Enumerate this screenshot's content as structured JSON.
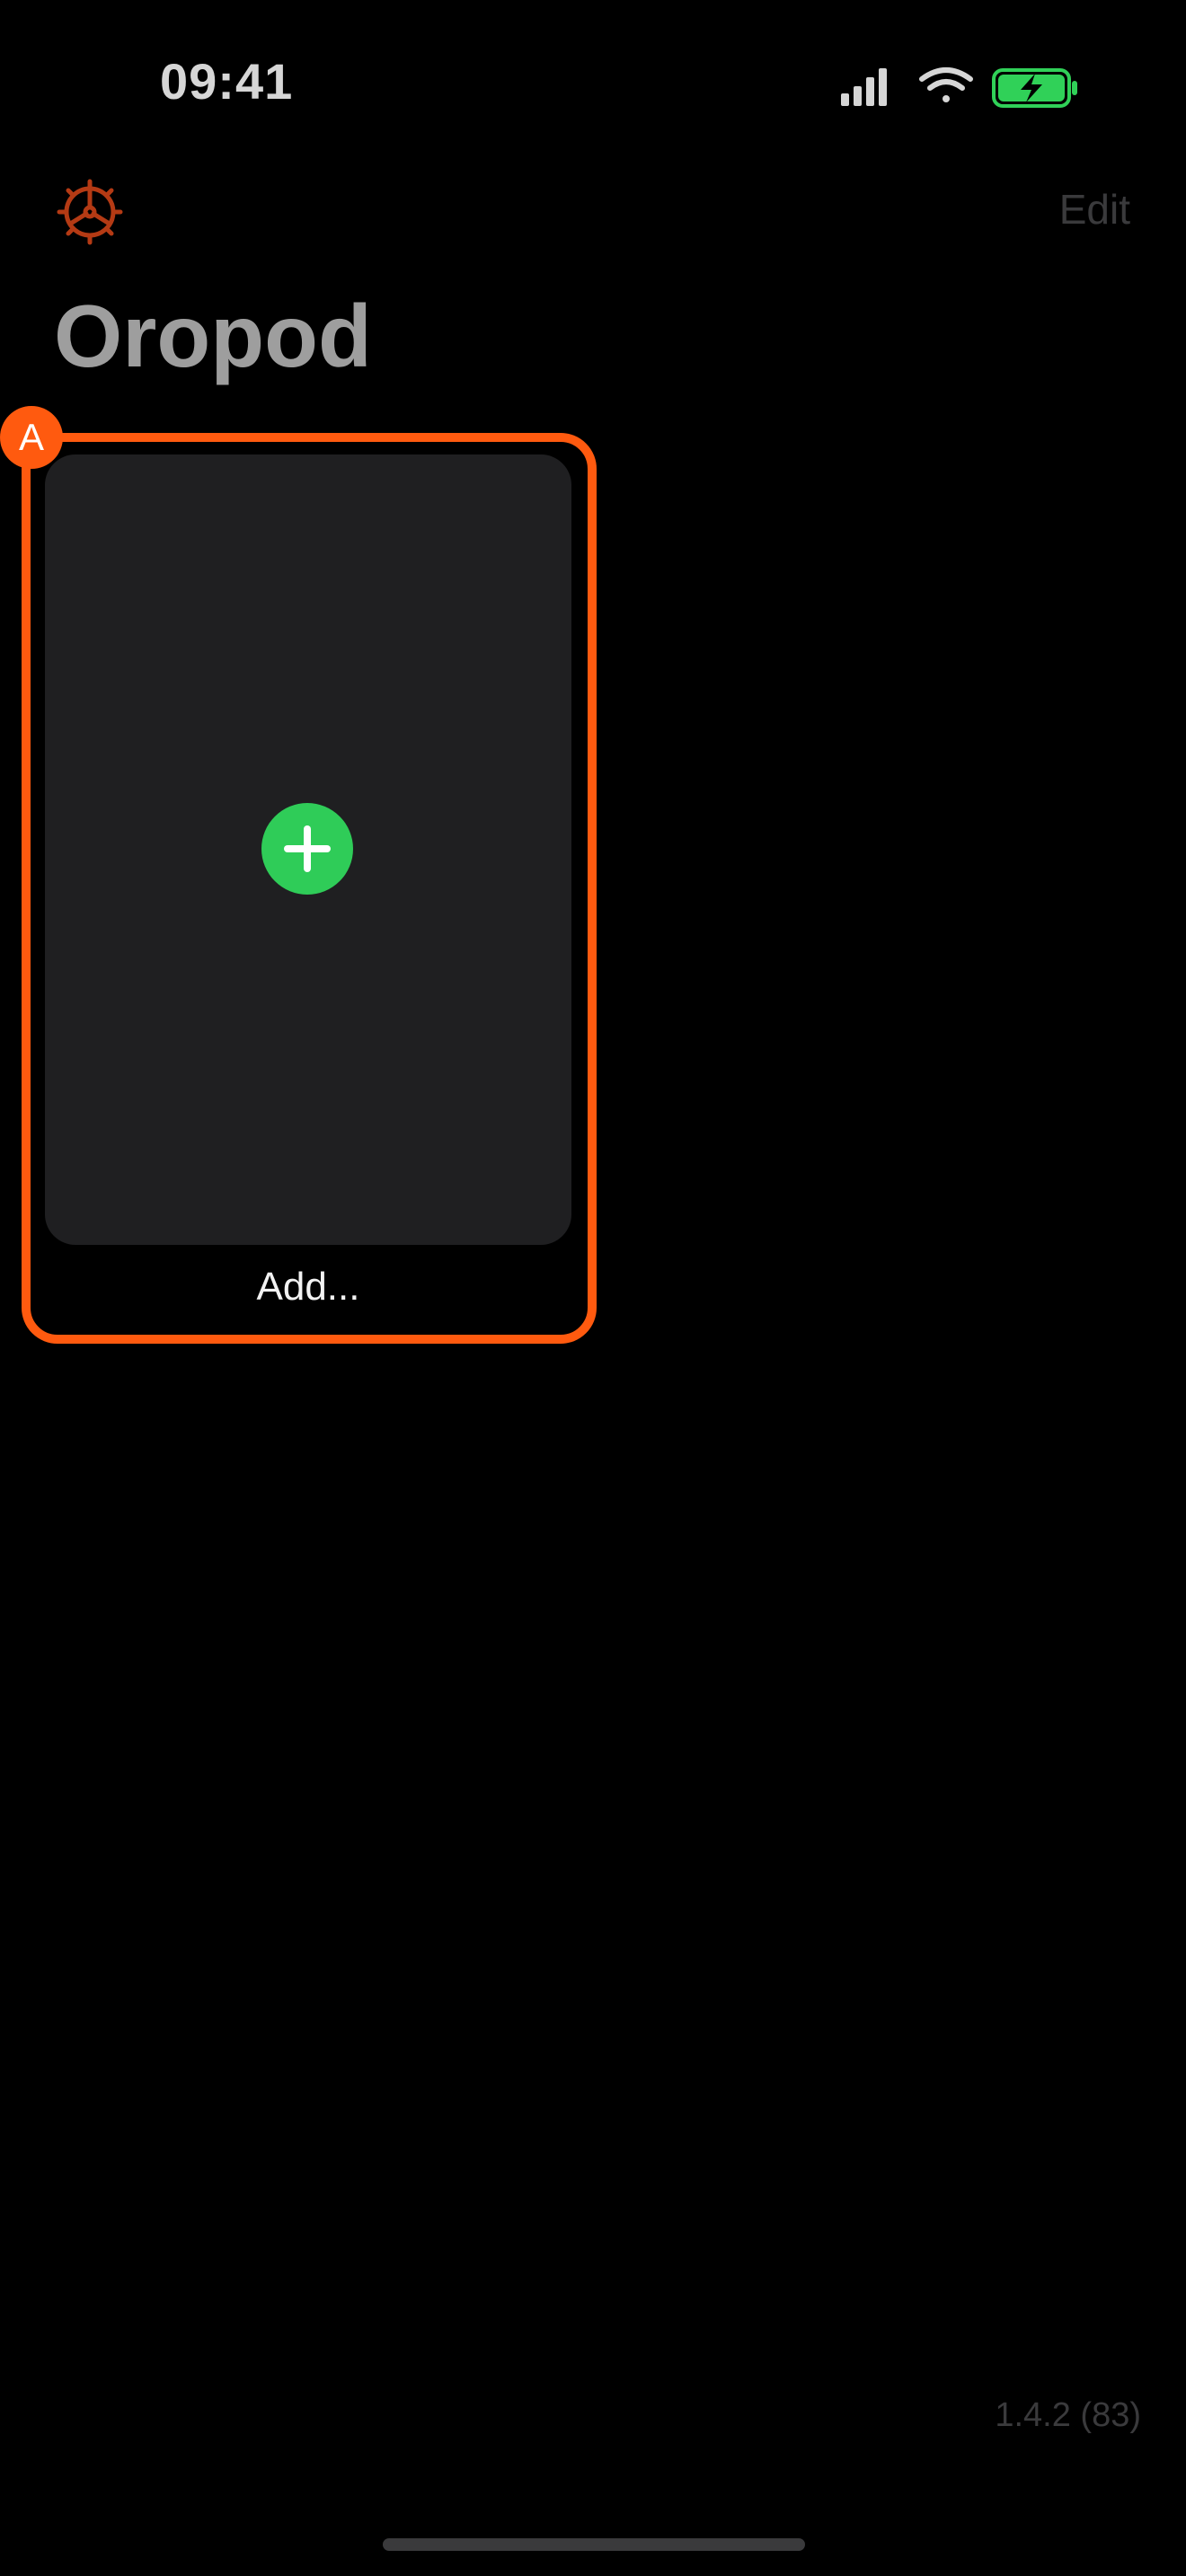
{
  "status_bar": {
    "time": "09:41",
    "icons": [
      "signal-icon",
      "wifi-icon",
      "battery-charging-icon"
    ],
    "battery_color": "#30d158"
  },
  "nav": {
    "settings_icon": "gear-icon",
    "edit_label": "Edit"
  },
  "page": {
    "title": "Oropod"
  },
  "highlight": {
    "badge_label": "A",
    "color": "#ff5a0f"
  },
  "add_card": {
    "label": "Add...",
    "plus_icon": "plus-icon",
    "plus_color": "#2fcc58"
  },
  "footer": {
    "version": "1.4.2 (83)"
  }
}
